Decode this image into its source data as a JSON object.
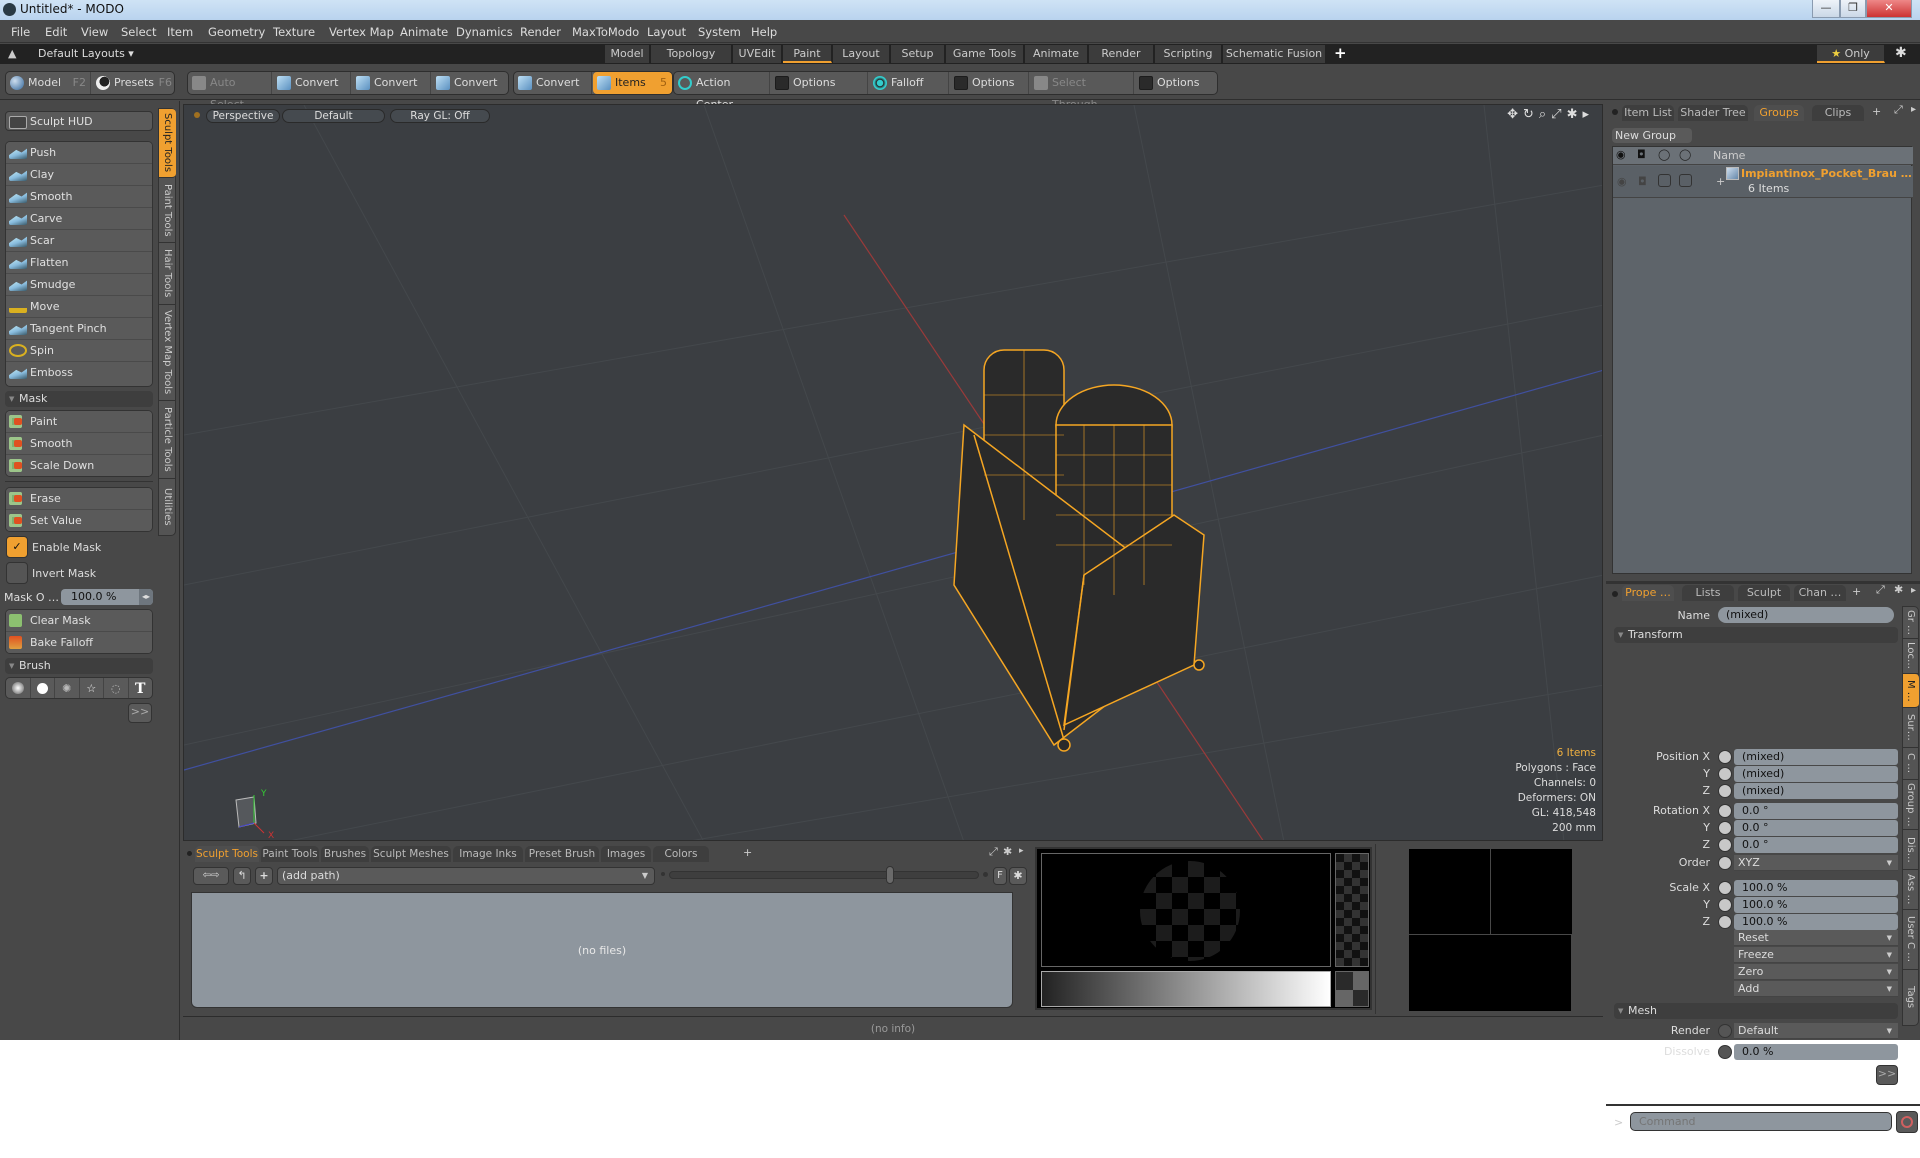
{
  "window": {
    "title": "Untitled* - MODO",
    "minimize": "—",
    "restore": "❐",
    "close": "✕"
  },
  "menu": [
    "File",
    "Edit",
    "View",
    "Select",
    "Item",
    "Geometry",
    "Texture",
    "Vertex Map",
    "Animate",
    "Dynamics",
    "Render",
    "MaxToModo",
    "Layout",
    "System",
    "Help"
  ],
  "layoutbar": {
    "layouts_label": "Default Layouts ▾",
    "tabs": [
      "Model",
      "Topology",
      "UVEdit",
      "Paint",
      "Layout",
      "Setup",
      "Game Tools",
      "Animate",
      "Render",
      "Scripting",
      "Schematic Fusion"
    ],
    "active_tab": "Paint",
    "add_tab": "+",
    "only_label": "Only",
    "star": "★"
  },
  "toolbar": {
    "model": "Model",
    "model_key": "F2",
    "presets": "Presets",
    "presets_key": "F6",
    "auto_select": "Auto Select",
    "convert1": "Convert",
    "convert2": "Convert",
    "convert3": "Convert",
    "convert4": "Convert",
    "items": "Items",
    "items_count": "5",
    "action_center": "Action Center",
    "options1": "Options",
    "falloff": "Falloff",
    "options2": "Options",
    "select_through": "Select Through",
    "options3": "Options"
  },
  "left": {
    "hud": "Sculpt HUD",
    "sculpt_tools": [
      "Push",
      "Clay",
      "Smooth",
      "Carve",
      "Scar",
      "Flatten",
      "Smudge",
      "Move",
      "Tangent Pinch",
      "Spin",
      "Emboss"
    ],
    "mask_header": "Mask",
    "mask_tools": [
      "Paint",
      "Smooth",
      "Scale Down"
    ],
    "mask_tools2": [
      "Erase",
      "Set Value"
    ],
    "enable_mask": "Enable Mask",
    "enable_mask_checked": true,
    "invert_mask": "Invert Mask",
    "invert_mask_checked": false,
    "mask_opacity_label": "Mask O …",
    "mask_opacity_value": "100.0 %",
    "mask_tools3": [
      "Clear Mask",
      "Bake Falloff"
    ],
    "brush_header": "Brush",
    "more": ">>",
    "vtabs": [
      "Sculpt Tools",
      "Paint Tools",
      "Hair Tools",
      "Vertex Map Tools",
      "Particle Tools",
      "Utilities"
    ],
    "active_vtab": "Sculpt Tools"
  },
  "viewport": {
    "view": "Perspective",
    "shading": "Default",
    "raygl": "Ray GL: Off",
    "stats": {
      "items": "6 Items",
      "polygons": "Polygons : Face",
      "channels": "Channels: 0",
      "deformers": "Deformers: ON",
      "gl": "GL: 418,548",
      "scale": "200 mm"
    },
    "axes": {
      "x": "X",
      "y": "Y",
      "z": "Z"
    },
    "model_color": "#f5a623"
  },
  "groups": {
    "tabs": [
      "Item List",
      "Shader Tree",
      "Groups",
      "Clips"
    ],
    "active_tab": "Groups",
    "new_group": "New Group",
    "name_header": "Name",
    "rows": [
      {
        "name": "Impiantinox_Pocket_Brau …",
        "sub": "6 Items"
      }
    ]
  },
  "properties": {
    "tabs": [
      "Prope …",
      "Lists",
      "Sculpt",
      "Chan …"
    ],
    "active_tab": "Prope …",
    "name_label": "Name",
    "name_value": "(mixed)",
    "transform_header": "Transform",
    "position": [
      {
        "label": "Position X",
        "value": "(mixed)"
      },
      {
        "label": "Y",
        "value": "(mixed)"
      },
      {
        "label": "Z",
        "value": "(mixed)"
      }
    ],
    "rotation": [
      {
        "label": "Rotation X",
        "value": "0.0 °"
      },
      {
        "label": "Y",
        "value": "0.0 °"
      },
      {
        "label": "Z",
        "value": "0.0 °"
      }
    ],
    "order_label": "Order",
    "order_value": "XYZ",
    "scale": [
      {
        "label": "Scale X",
        "value": "100.0 %"
      },
      {
        "label": "Y",
        "value": "100.0 %"
      },
      {
        "label": "Z",
        "value": "100.0 %"
      }
    ],
    "actions": [
      "Reset",
      "Freeze",
      "Zero",
      "Add"
    ],
    "mesh_header": "Mesh",
    "render_label": "Render",
    "render_value": "Default",
    "dissolve_label": "Dissolve",
    "dissolve_value": "0.0 %",
    "more": ">>",
    "vtabs": [
      "Gr …",
      "Loc…",
      "M …",
      "Sur…",
      "C …",
      "Group …",
      "Dis…",
      "Ass …",
      "User C …",
      "Tags"
    ],
    "active_vtab": "M …",
    "command_placeholder": "Command",
    "prompt": ">"
  },
  "bottom": {
    "tabs": [
      "Sculpt Tools",
      "Paint Tools",
      "Brushes",
      "Sculpt Meshes",
      "Image Inks",
      "Preset Brush",
      "Images",
      "Colors"
    ],
    "active_tab": "Sculpt Tools",
    "add_tab": "+",
    "path": "(add path)",
    "filter_btn": "F",
    "empty": "(no files)",
    "status": "(no info)"
  }
}
